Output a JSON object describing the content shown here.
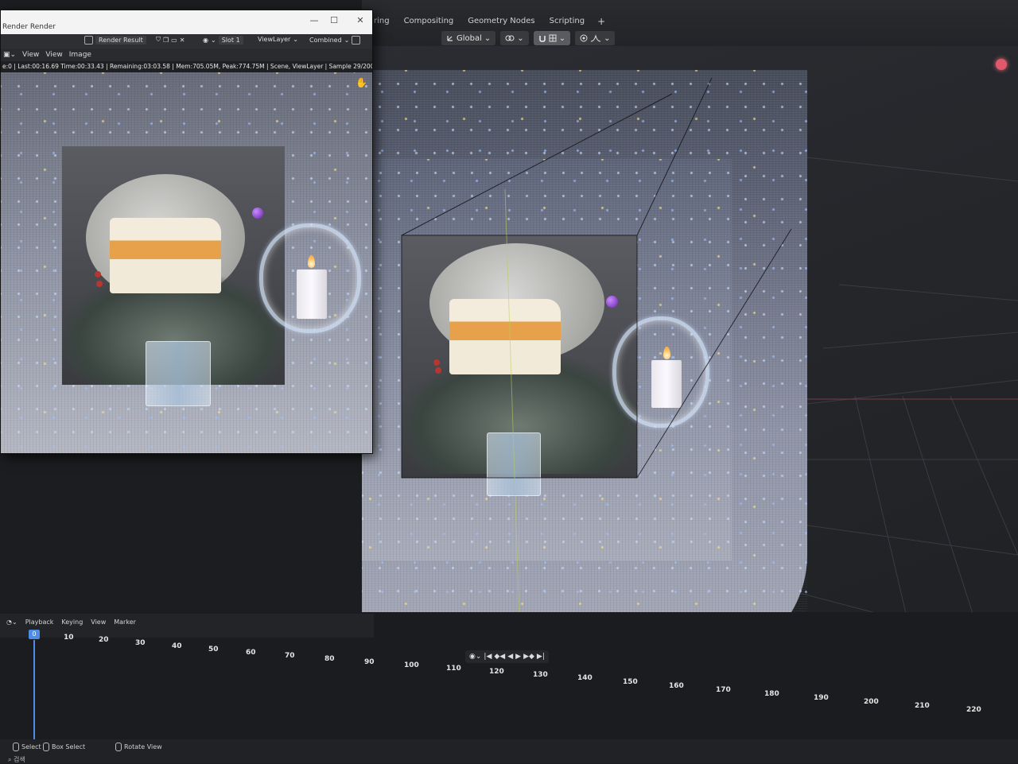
{
  "workspace": {
    "tabs": [
      "ring",
      "Compositing",
      "Geometry Nodes",
      "Scripting",
      "+"
    ],
    "toolbar": {
      "orientation": "Global",
      "icons": [
        "global-axes-icon",
        "link-icon",
        "snap-icon",
        "proportional-icon",
        "falloff-icon"
      ]
    },
    "record_color": "#e0586a"
  },
  "render_window": {
    "title": "Render Render",
    "window_controls": [
      "—",
      "☐",
      "✕"
    ],
    "header": {
      "image_name": "Render Result",
      "slot": "Slot 1",
      "view_layer": "ViewLayer",
      "pass": "Combined"
    },
    "menu": [
      "View",
      "View",
      "Image"
    ],
    "status": "e:0 | Last:00:16.69 Time:00:33.43 | Remaining:03:03.58 | Mem:705.05M, Peak:774.75M | Scene, ViewLayer | Sample 29/200"
  },
  "timeline": {
    "menu": [
      "Playback",
      "Keying",
      "View",
      "Marker"
    ],
    "current_frame": "0",
    "ticks": [
      "10",
      "20",
      "30",
      "40",
      "50",
      "60",
      "70",
      "80",
      "90",
      "100",
      "110",
      "120",
      "130",
      "140",
      "150",
      "160",
      "170",
      "180",
      "190",
      "200",
      "210",
      "220"
    ],
    "accent": "#4f8ce6"
  },
  "status_bar": {
    "items": [
      "Select",
      "Box Select",
      "Rotate View"
    ],
    "search": "검색"
  }
}
